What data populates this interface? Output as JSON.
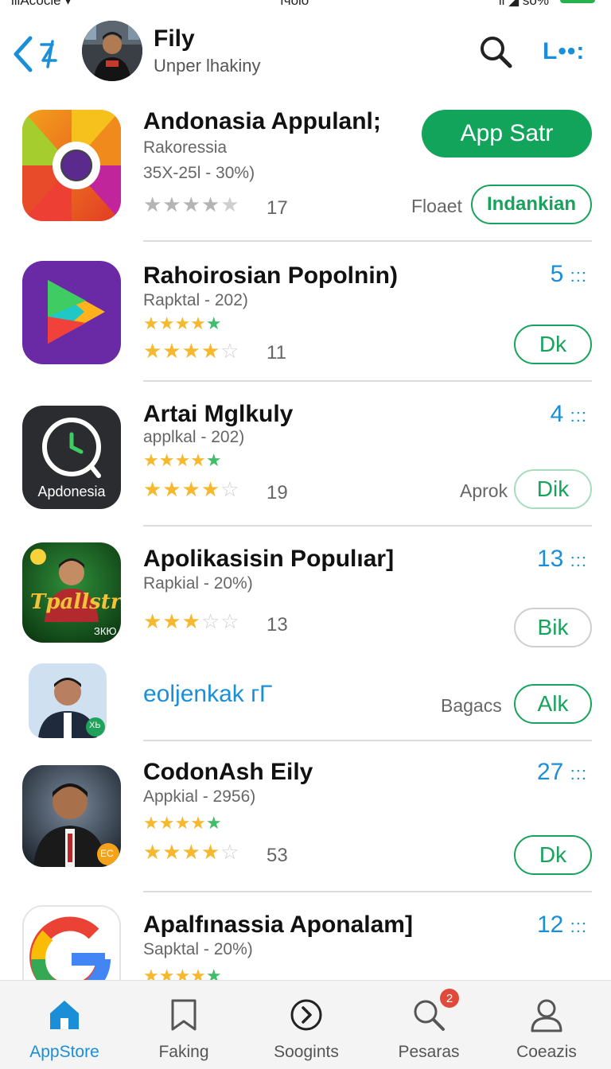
{
  "status_bar": {
    "left": "lllАсосlе ▾",
    "center": "ıчolo",
    "right": "ll ◢ ѕо%"
  },
  "header": {
    "title": "Fily",
    "subtitle": "Unper lhakiny",
    "more_label": "L••:",
    "icons": {
      "back": "chevron-left-icon",
      "search": "search-icon"
    }
  },
  "apps": [
    {
      "name": "Andonasia Appulanl;",
      "publisher": "Rakoressia",
      "detail": "35X-25l - 30%)",
      "rating_count": "17",
      "primary_button": "App Satr",
      "side_label": "Floaet",
      "secondary_button": "Indankian",
      "colors": {
        "accent": "#13a45c"
      }
    },
    {
      "name": "Rahoirosian Popolnin)",
      "publisher": "Rapktal - 202)",
      "rating_count": "11",
      "rank": "5",
      "rank_dots": ":::",
      "button": "Dk"
    },
    {
      "name": "Artai Mglkuly",
      "publisher": "applkal - 202)",
      "rating_count": "19",
      "rank": "4",
      "rank_dots": ":::",
      "side_label": "Aprok",
      "button": "Dik",
      "icon_caption": "Apdonesia"
    },
    {
      "name": "Apolikasisin Populıar]",
      "publisher": "Rapkial - 20%)",
      "rating_count": "13",
      "rank": "13",
      "rank_dots": ":::",
      "button": "Bik",
      "icon_caption": "Tpallstre",
      "icon_small": "ЗКЮ"
    },
    {
      "name": "eoljenkak гГ",
      "side_label": "Bagacs",
      "button": "Alk",
      "icon_badge": "ХЬ"
    },
    {
      "name": "CodonAsh Eily",
      "publisher": "Appkial - 2956)",
      "rating_count": "53",
      "rank": "27",
      "rank_dots": ":::",
      "button": "Dk",
      "icon_badge": "ЕС"
    },
    {
      "name": "Apalfınassia Aponalam]",
      "publisher": "Sapktal - 20%)",
      "rank": "12",
      "rank_dots": ":::"
    }
  ],
  "tabs": [
    {
      "label": "AppStore",
      "icon": "home-icon",
      "active": true
    },
    {
      "label": "Faking",
      "icon": "bookmark-icon"
    },
    {
      "label": "Soogints",
      "icon": "arrow-circle-icon"
    },
    {
      "label": "Pesaras",
      "icon": "search-icon",
      "badge": "2"
    },
    {
      "label": "Coeazis",
      "icon": "person-icon"
    }
  ]
}
